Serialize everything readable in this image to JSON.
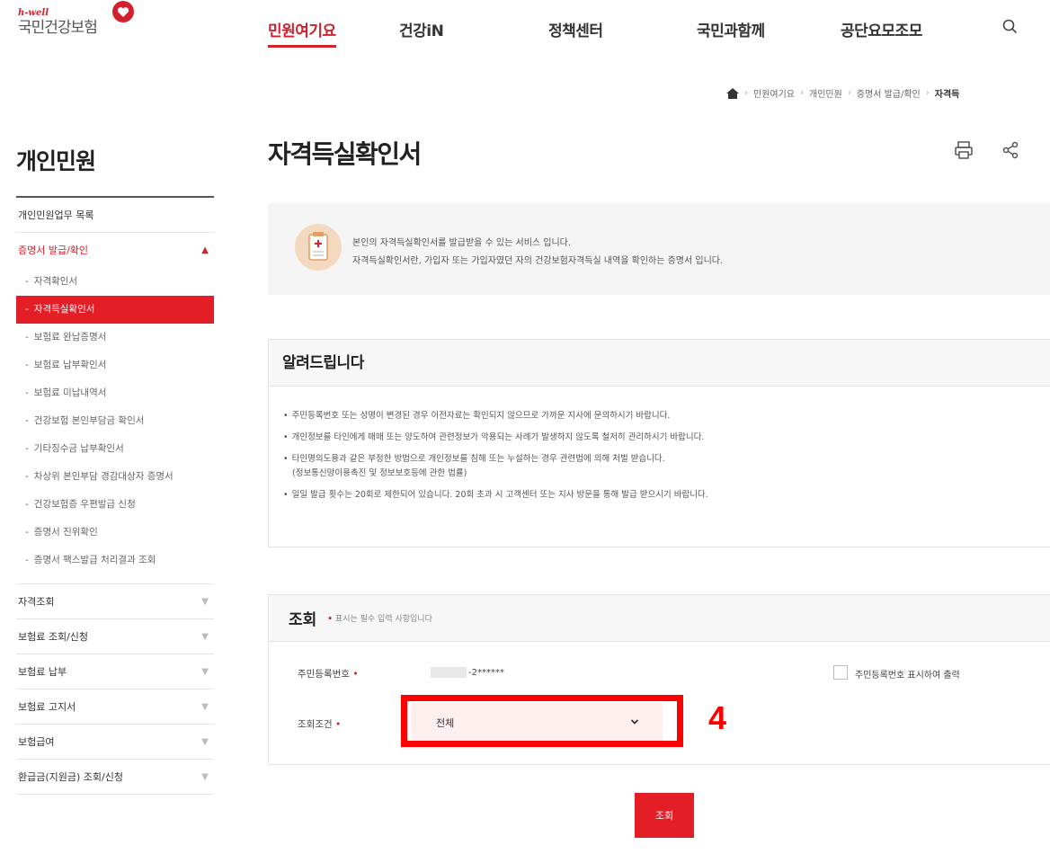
{
  "header": {
    "logo_en": "h-well",
    "logo_ko": "국민건강보험",
    "gnb": [
      {
        "label": "민원여기요",
        "active": true
      },
      {
        "label": "건강iN",
        "active": false
      },
      {
        "label": "정책센터",
        "active": false
      },
      {
        "label": "국민과함께",
        "active": false
      },
      {
        "label": "공단요모조모",
        "active": false
      }
    ]
  },
  "breadcrumb": [
    "민원여기요",
    "개인민원",
    "증명서 발급/확인",
    "자격득"
  ],
  "sidebar": {
    "title": "개인민원",
    "items": [
      {
        "label": "개인민원업무 목록"
      },
      {
        "label": "증명서 발급/확인",
        "open": true,
        "children": [
          {
            "label": "자격확인서",
            "active": false
          },
          {
            "label": "자격득실확인서",
            "active": true
          },
          {
            "label": "보험료 완납증명서",
            "active": false
          },
          {
            "label": "보험료 납부확인서",
            "active": false
          },
          {
            "label": "보험료 미납내역서",
            "active": false
          },
          {
            "label": "건강보험 본인부담금 확인서",
            "active": false
          },
          {
            "label": "기타징수금 납부확인서",
            "active": false
          },
          {
            "label": "차상위 본인부담 경감대상자 증명서",
            "active": false
          },
          {
            "label": "건강보험증 우편발급 신청",
            "active": false
          },
          {
            "label": "증명서 진위확인",
            "active": false
          },
          {
            "label": "증명서 팩스발급 처리결과 조회",
            "active": false
          }
        ]
      },
      {
        "label": "자격조회"
      },
      {
        "label": "보험료 조회/신청"
      },
      {
        "label": "보험료 납부"
      },
      {
        "label": "보험료 고지서"
      },
      {
        "label": "보험급여"
      },
      {
        "label": "환급금(지원금) 조회/신청"
      }
    ]
  },
  "main": {
    "title": "자격득실확인서",
    "intro": [
      "본인의 자격득실확인서를 발급받을 수 있는 서비스 입니다.",
      "자격득실확인서란, 가입자 또는 가입자였던 자의 건강보험자격득실 내역을 확인하는 증명서 입니다."
    ],
    "notice": {
      "title": "알려드립니다",
      "items": [
        {
          "text": "주민등록번호 또는 성명이 변경된 경우 이전자료는 확인되지 않으므로 가까운 지사에 문의하시기 바랍니다.",
          "cont": ""
        },
        {
          "text": "개인정보를 타인에게 매매 또는 양도하여 관련정보가 악용되는 사례가 발생하지 않도록 철저히 관리하시기 바랍니다.",
          "cont": ""
        },
        {
          "text": "타인명의도용과 같은 부정한 방법으로 개인정보를 침해 또는 누설하는 경우 관련법에 의해 처벌 받습니다.",
          "cont": "(정보통신망이용촉진 및 정보보호등에 관한 법률)"
        },
        {
          "text": "일일 발급 횟수는 20회로 제한되어 있습니다. 20회 초과 시 고객센터 또는 지사 방문을 통해 발급 받으시기 바랍니다.",
          "cont": ""
        }
      ]
    },
    "query": {
      "title": "조회",
      "required_note": "표시는 필수 입력 사항입니다",
      "rrn_label": "주민등록번호",
      "rrn_value": "-2******",
      "show_rrn_label": "주민등록번호 표시하여 출력",
      "condition_label": "조회조건",
      "condition_value": "전체",
      "submit_label": "조회"
    }
  },
  "annotation": {
    "step": "4",
    "color": "#ff0000"
  },
  "colors": {
    "brand": "#d4202c",
    "active_bg": "#e41e26"
  }
}
